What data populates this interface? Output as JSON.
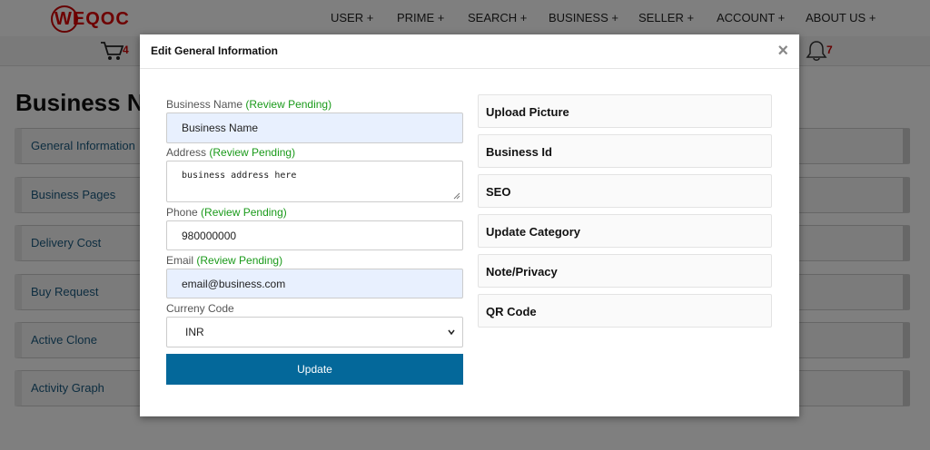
{
  "header": {
    "logo_text": "WEQOC",
    "nav": [
      "USER +",
      "PRIME +",
      "SEARCH +",
      "BUSINESS +",
      "SELLER +",
      "ACCOUNT +",
      "ABOUT US +"
    ],
    "cart_count": "4",
    "notification_count": "7"
  },
  "page": {
    "title": "Business N",
    "menu": [
      "General Information",
      "Business Pages",
      "Delivery Cost",
      "Buy Request",
      "Active Clone",
      "Activity Graph"
    ]
  },
  "modal": {
    "title": "Edit General Information",
    "close_label": "×",
    "pending_label": "(Review Pending)",
    "fields": {
      "business_name": {
        "label": "Business Name",
        "value": "Business Name"
      },
      "address": {
        "label": "Address",
        "value": "business address here"
      },
      "phone": {
        "label": "Phone",
        "value": "980000000"
      },
      "email": {
        "label": "Email",
        "value": "email@business.com"
      },
      "currency": {
        "label": "Curreny Code",
        "value": "INR"
      }
    },
    "update_label": "Update",
    "panels": [
      "Upload Picture",
      "Business Id",
      "SEO",
      "Update Category",
      "Note/Privacy",
      "QR Code"
    ]
  },
  "colors": {
    "accent": "#04689a",
    "pending": "#1a9a1a",
    "brand_red": "#dd0000",
    "link": "#1b5a80"
  }
}
